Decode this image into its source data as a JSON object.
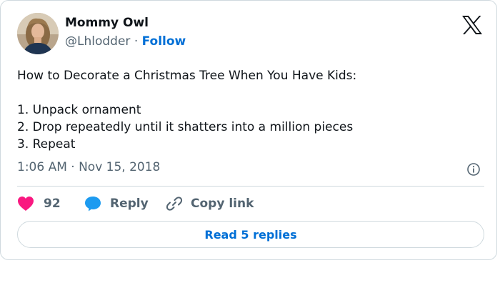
{
  "author": {
    "name": "Mommy Owl",
    "handle": "@Lhlodder",
    "separator": "·",
    "follow_label": "Follow"
  },
  "tweet": {
    "lines": [
      "How to Decorate a Christmas Tree When You Have Kids:",
      "",
      "1. Unpack ornament",
      "2. Drop repeatedly until it shatters into a million pieces",
      "3. Repeat"
    ],
    "timestamp": "1:06 AM · Nov 15, 2018"
  },
  "actions": {
    "like_count": "92",
    "reply_label": "Reply",
    "copy_label": "Copy link"
  },
  "read_replies_label": "Read 5 replies",
  "colors": {
    "heart": "#f91880",
    "reply_bubble": "#1d9bf0",
    "link_blue": "#006fd6",
    "muted_text": "#536471",
    "border": "#cfd9de"
  },
  "icons": {
    "logo": "x-logo-icon",
    "info": "info-icon",
    "like": "heart-icon",
    "reply": "speech-bubble-icon",
    "copy": "link-icon"
  }
}
